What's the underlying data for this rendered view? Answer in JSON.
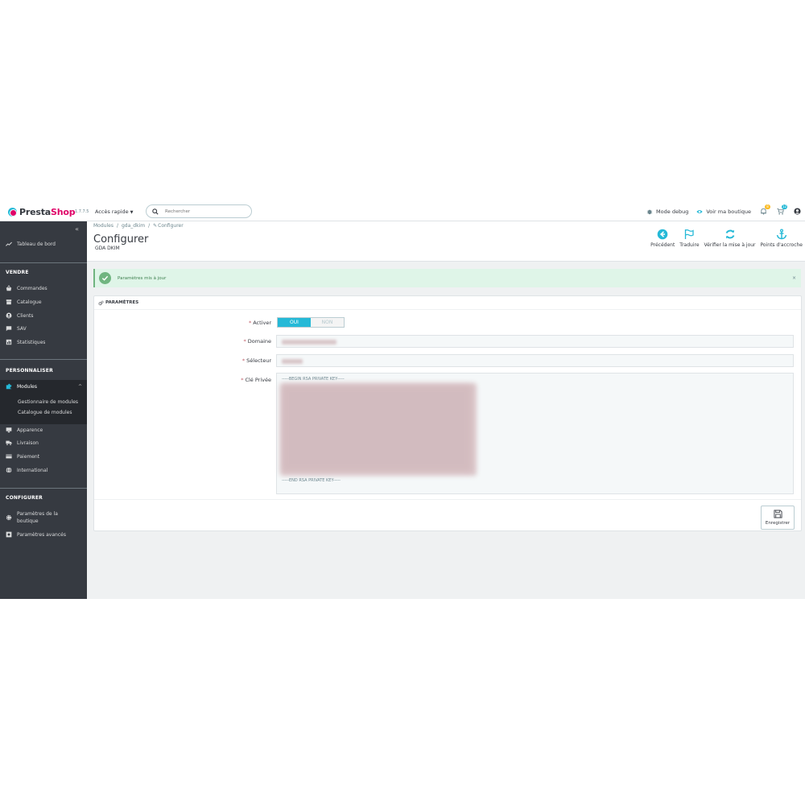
{
  "header": {
    "logo_prefix": "Presta",
    "logo_suffix": "Shop",
    "version": "1.7.7.5",
    "quick_access": "Accès rapide",
    "search_placeholder": "Rechercher",
    "debug_label": "Mode debug",
    "view_shop_label": "Voir ma boutique",
    "notif_badge": "8",
    "cart_badge": "12"
  },
  "sidebar": {
    "dashboard": "Tableau de bord",
    "section_sell": "VENDRE",
    "sell_items": [
      "Commandes",
      "Catalogue",
      "Clients",
      "SAV",
      "Statistiques"
    ],
    "section_customize": "PERSONNALISER",
    "modules": "Modules",
    "modules_sub": [
      "Gestionnaire de modules",
      "Catalogue de modules"
    ],
    "customize_items": [
      "Apparence",
      "Livraison",
      "Paiement",
      "International"
    ],
    "section_configure": "CONFIGURER",
    "shop_params_line1": "Paramètres de la",
    "shop_params_line2": "boutique",
    "advanced_params": "Paramètres avancés"
  },
  "page": {
    "breadcrumb": [
      "Modules",
      "/",
      "gda_dkim",
      "/",
      "Configurer"
    ],
    "title": "Configurer",
    "subtitle": "GDA DKIM",
    "toolbar": [
      "Précédent",
      "Traduire",
      "Vérifier la mise à jour",
      "Points d'accroche"
    ]
  },
  "alert": {
    "message": "Paramètres mis à jour",
    "close": "×"
  },
  "form": {
    "panel_title": "PARAMÈTRES",
    "required_mark": "*",
    "activate_label": "Activer",
    "toggle_on": "OUI",
    "toggle_off": "NON",
    "domain_label": "Domaine",
    "selector_label": "Sélecteur",
    "key_label": "Clé Privée",
    "key_begin": "-----BEGIN RSA PRIVATE KEY-----",
    "key_end": "-----END RSA PRIVATE KEY-----",
    "save_label": "Enregistrer"
  },
  "colors": {
    "primary": "#25b9d7",
    "sidebar_bg": "#363a41",
    "success_bg": "#dff5e8",
    "success": "#70b580",
    "brand_pink": "#df0067",
    "badge_orange": "#fbbb22"
  }
}
